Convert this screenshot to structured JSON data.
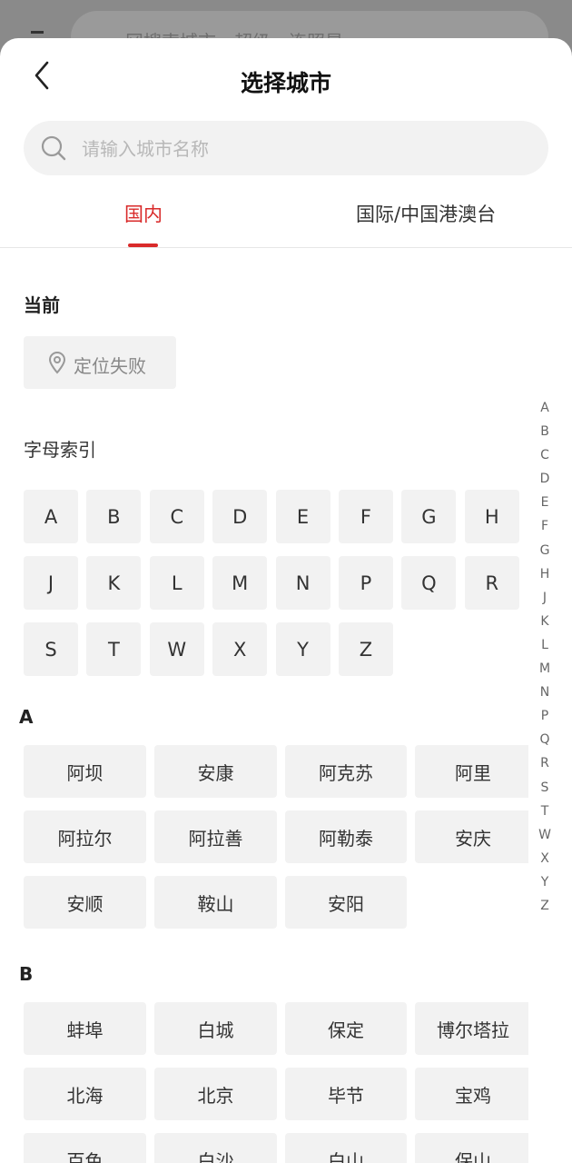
{
  "background": {
    "search_text": "冈搜索城市、超级、连照是"
  },
  "header": {
    "title": "选择城市"
  },
  "search": {
    "placeholder": "请输入城市名称"
  },
  "tabs": [
    {
      "label": "国内",
      "active": true
    },
    {
      "label": "国际/中国港澳台",
      "active": false
    }
  ],
  "current": {
    "heading": "当前",
    "location_text": "定位失败"
  },
  "index": {
    "heading": "字母索引",
    "letters": [
      "A",
      "B",
      "C",
      "D",
      "E",
      "F",
      "G",
      "H",
      "J",
      "K",
      "L",
      "M",
      "N",
      "P",
      "Q",
      "R",
      "S",
      "T",
      "W",
      "X",
      "Y",
      "Z"
    ]
  },
  "sections": [
    {
      "letter": "A",
      "cities": [
        "阿坝",
        "安康",
        "阿克苏",
        "阿里",
        "阿拉尔",
        "阿拉善",
        "阿勒泰",
        "安庆",
        "安顺",
        "鞍山",
        "安阳"
      ]
    },
    {
      "letter": "B",
      "cities": [
        "蚌埠",
        "白城",
        "保定",
        "博尔塔拉",
        "北海",
        "北京",
        "毕节",
        "宝鸡",
        "百色",
        "白沙",
        "白山",
        "保山"
      ]
    }
  ],
  "side_index": [
    "A",
    "B",
    "C",
    "D",
    "E",
    "F",
    "G",
    "H",
    "J",
    "K",
    "L",
    "M",
    "N",
    "P",
    "Q",
    "R",
    "S",
    "T",
    "W",
    "X",
    "Y",
    "Z"
  ],
  "colors": {
    "accent": "#d92a2a",
    "chip_bg": "#f2f2f2"
  }
}
